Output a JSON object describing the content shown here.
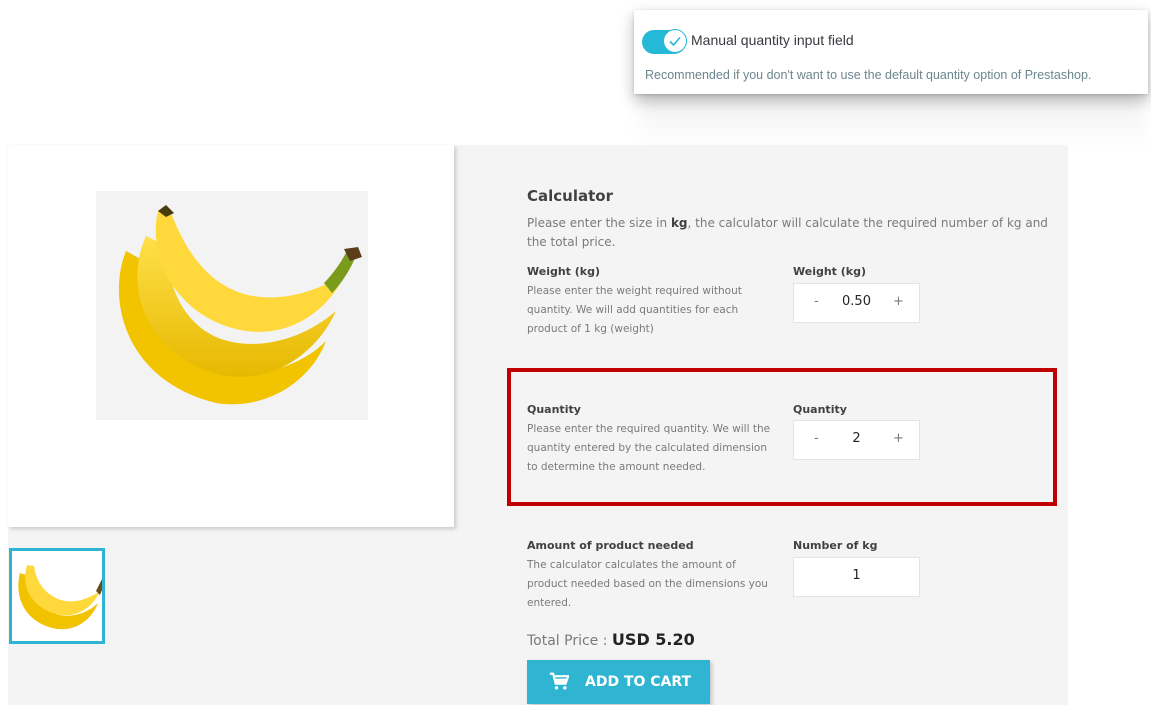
{
  "setting": {
    "toggle_state": "on",
    "title": "Manual quantity input field",
    "help": "Recommended if you don't want to use the default quantity option of Prestashop."
  },
  "calculator": {
    "title": "Calculator",
    "desc_before": "Please enter the size in ",
    "desc_bold": "kg",
    "desc_after": ", the calculator will calculate the required number of kg and the total price.",
    "weight": {
      "label": "Weight (kg)",
      "desc": "Please enter the weight required without quantity. We will add quantities for each product of 1 kg (weight)",
      "input_label": "Weight (kg)",
      "value": "0.50",
      "minus": "-",
      "plus": "+"
    },
    "quantity": {
      "label": "Quantity",
      "desc": "Please enter the required quantity. We will the quantity entered by the calculated dimension to determine the amount needed.",
      "input_label": "Quantity",
      "value": "2",
      "minus": "-",
      "plus": "+"
    },
    "amount": {
      "label": "Amount of product needed",
      "desc": "The calculator calculates the amount of product needed based on the dimensions you entered.",
      "input_label": "Number of kg",
      "value": "1"
    },
    "total_label": "Total Price : ",
    "total_value": "USD 5.20",
    "add_to_cart": "ADD TO CART"
  },
  "colors": {
    "accent": "#2fb5d2",
    "toggle": "#25b9d7",
    "highlight": "#c00000"
  }
}
